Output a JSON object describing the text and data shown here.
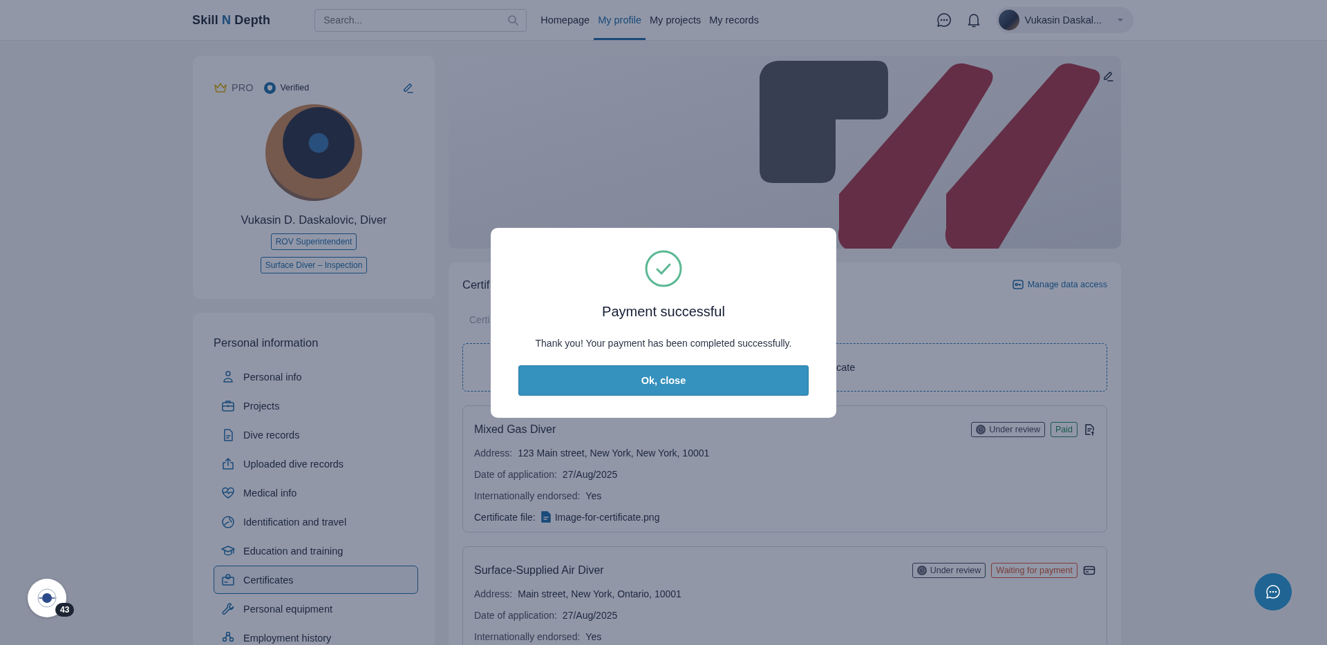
{
  "header": {
    "logo": [
      {
        "text": "Skill",
        "accent": false
      },
      {
        "text": "N",
        "accent": true
      },
      {
        "text": "Depth",
        "accent": false
      }
    ],
    "search": {
      "placeholder": "Search..."
    },
    "nav": [
      {
        "label": "Homepage",
        "selected": false
      },
      {
        "label": "My profile",
        "selected": true
      },
      {
        "label": "My projects",
        "selected": false
      },
      {
        "label": "My records",
        "selected": false
      }
    ],
    "user": {
      "name": "Vukasin Daskal..."
    }
  },
  "profile": {
    "plan": "PRO",
    "verified": "Verified",
    "name": "Vukasin D. Daskalovic, Diver",
    "roles": [
      "ROV Superintendent",
      "Surface Diver – Inspection"
    ]
  },
  "sidebar": {
    "title": "Personal information",
    "items": [
      {
        "label": "Personal info",
        "selected": false
      },
      {
        "label": "Projects",
        "selected": false
      },
      {
        "label": "Dive records",
        "selected": false
      },
      {
        "label": "Uploaded dive records",
        "selected": false
      },
      {
        "label": "Medical info",
        "selected": false
      },
      {
        "label": "Identification and travel",
        "selected": false
      },
      {
        "label": "Education and training",
        "selected": false
      },
      {
        "label": "Certificates",
        "selected": true
      },
      {
        "label": "Personal equipment",
        "selected": false
      },
      {
        "label": "Employment history",
        "selected": false
      }
    ]
  },
  "certificates": {
    "title": "Certif",
    "manage_link": "Manage data access",
    "tab": "Certi",
    "add_box": "cate",
    "cards": [
      {
        "title": "Mixed Gas Diver",
        "badges": [
          {
            "label": "Under review",
            "kind": "review"
          },
          {
            "label": "Paid",
            "kind": "paid"
          }
        ],
        "fields": [
          {
            "label": "Address:",
            "value": "123 Main street, New York, New York, 10001"
          },
          {
            "label": "Date of application:",
            "value": "27/Aug/2025"
          },
          {
            "label": "Internationally endorsed:",
            "value": "Yes"
          }
        ],
        "file": {
          "label": "Certificate file:",
          "name": "Image-for-certificate.png"
        }
      },
      {
        "title": "Surface-Supplied Air Diver",
        "badges": [
          {
            "label": "Under review",
            "kind": "review"
          },
          {
            "label": "Waiting for payment",
            "kind": "waiting"
          }
        ],
        "fields": [
          {
            "label": "Address:",
            "value": "Main street, New York, Ontario, 10001"
          },
          {
            "label": "Date of application:",
            "value": "27/Aug/2025"
          },
          {
            "label": "Internationally endorsed:",
            "value": "Yes"
          }
        ]
      }
    ]
  },
  "modal": {
    "title": "Payment successful",
    "message": "Thank you! Your payment has been completed successfully.",
    "button": "Ok, close"
  },
  "widget": {
    "count": "43"
  }
}
